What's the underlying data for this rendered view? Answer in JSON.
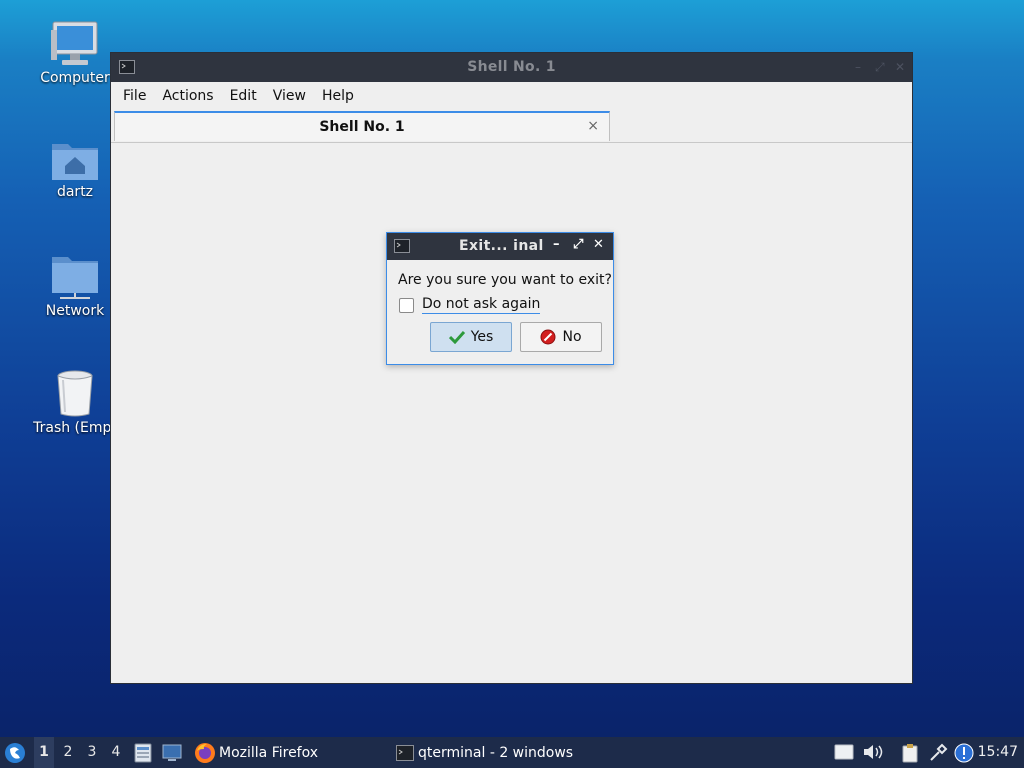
{
  "desktop": {
    "icons": [
      {
        "label": "Computer"
      },
      {
        "label": "dartz"
      },
      {
        "label": "Network"
      },
      {
        "label": "Trash (Empt"
      }
    ]
  },
  "window": {
    "title": "Shell No. 1",
    "menu": [
      "File",
      "Actions",
      "Edit",
      "View",
      "Help"
    ],
    "tab": {
      "title": "Shell No. 1",
      "close_glyph": "×"
    }
  },
  "dialog": {
    "title": "Exit... inal",
    "message": "Are you sure you want to exit?",
    "checkbox_label": "Do not ask again",
    "checkbox_checked": false,
    "yes_label": "Yes",
    "no_label": "No"
  },
  "taskbar": {
    "workspaces": [
      "1",
      "2",
      "3",
      "4"
    ],
    "active_workspace": "1",
    "firefox_label": "Mozilla Firefox",
    "terminal_label": "qterminal - 2 windows",
    "clock": "15:47"
  },
  "colors": {
    "accent": "#3c8ce7",
    "titlebar": "#2f343f",
    "taskbar": "#1d2b4a"
  }
}
